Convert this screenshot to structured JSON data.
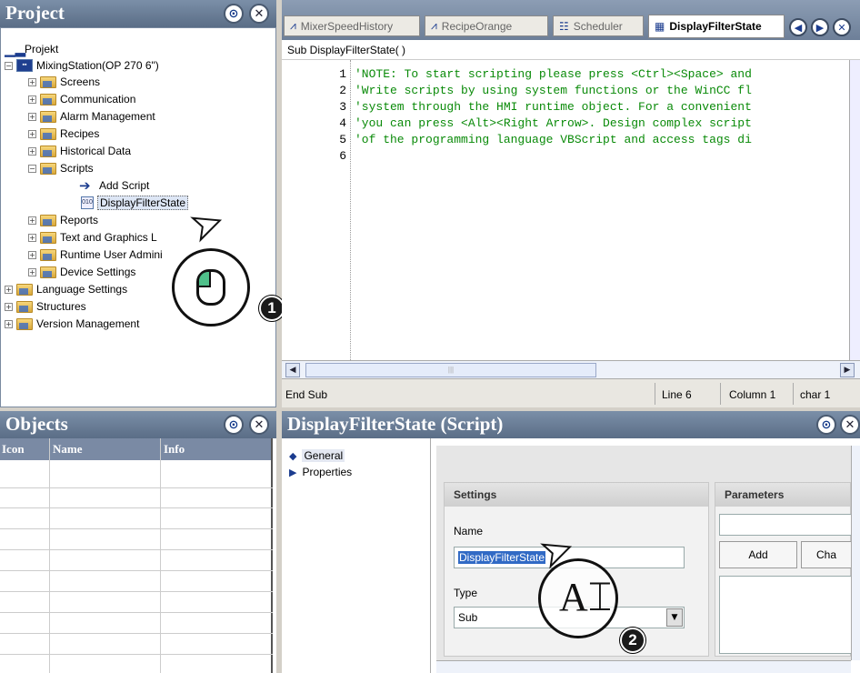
{
  "project_pane": {
    "title": "Project",
    "tree": [
      {
        "label": "Projekt",
        "level": 0
      },
      {
        "label": "MixingStation(OP 270 6\")",
        "level": 1,
        "expanded": true
      },
      {
        "label": "Screens",
        "level": 2
      },
      {
        "label": "Communication",
        "level": 2
      },
      {
        "label": "Alarm Management",
        "level": 2
      },
      {
        "label": "Recipes",
        "level": 2
      },
      {
        "label": "Historical Data",
        "level": 2
      },
      {
        "label": "Scripts",
        "level": 2,
        "expanded": true
      },
      {
        "label": "Add Script",
        "level": 3
      },
      {
        "label": "DisplayFilterState",
        "level": 3,
        "selected": true
      },
      {
        "label": "Reports",
        "level": 2
      },
      {
        "label": "Text and Graphics L",
        "level": 2
      },
      {
        "label": "Runtime User Admini",
        "level": 2
      },
      {
        "label": "Device Settings",
        "level": 2
      },
      {
        "label": "Language Settings",
        "level": 1
      },
      {
        "label": "Structures",
        "level": 1
      },
      {
        "label": "Version Management",
        "level": 1
      }
    ]
  },
  "editor": {
    "tabs": [
      {
        "label": "MixerSpeedHistory"
      },
      {
        "label": "RecipeOrange"
      },
      {
        "label": "Scheduler"
      },
      {
        "label": "DisplayFilterState",
        "active": true
      }
    ],
    "sub_line": "Sub DisplayFilterState( )",
    "line_numbers": [
      "1",
      "2",
      "3",
      "4",
      "5",
      "6"
    ],
    "code_lines": [
      "'NOTE: To start scripting please press <Ctrl><Space> and",
      "'Write scripts by using system functions or the WinCC fl",
      "'system through the HMI runtime object. For a convenient",
      "'you can press <Alt><Right Arrow>. Design complex script",
      "'of the programming language VBScript and access tags di",
      ""
    ],
    "status": {
      "end_text": "End Sub",
      "line": "Line 6",
      "column": "Column 1",
      "char": "char 1"
    }
  },
  "objects_pane": {
    "title": "Objects",
    "columns": [
      "Icon",
      "Name",
      "Info"
    ]
  },
  "properties_pane": {
    "title": "DisplayFilterState (Script)",
    "nav": [
      "General",
      "Properties"
    ],
    "settings": {
      "title": "Settings",
      "name_label": "Name",
      "name_value": "DisplayFilterState",
      "type_label": "Type",
      "type_value": "Sub"
    },
    "parameters": {
      "title": "Parameters",
      "add_label": "Add",
      "change_label": "Cha"
    }
  },
  "callouts": {
    "one": "1",
    "two": "2",
    "text_cursor_glyph": "A"
  },
  "colors": {
    "header_bg": "#6d7f98",
    "code_text": "#098a08",
    "selection": "#316ac5"
  }
}
